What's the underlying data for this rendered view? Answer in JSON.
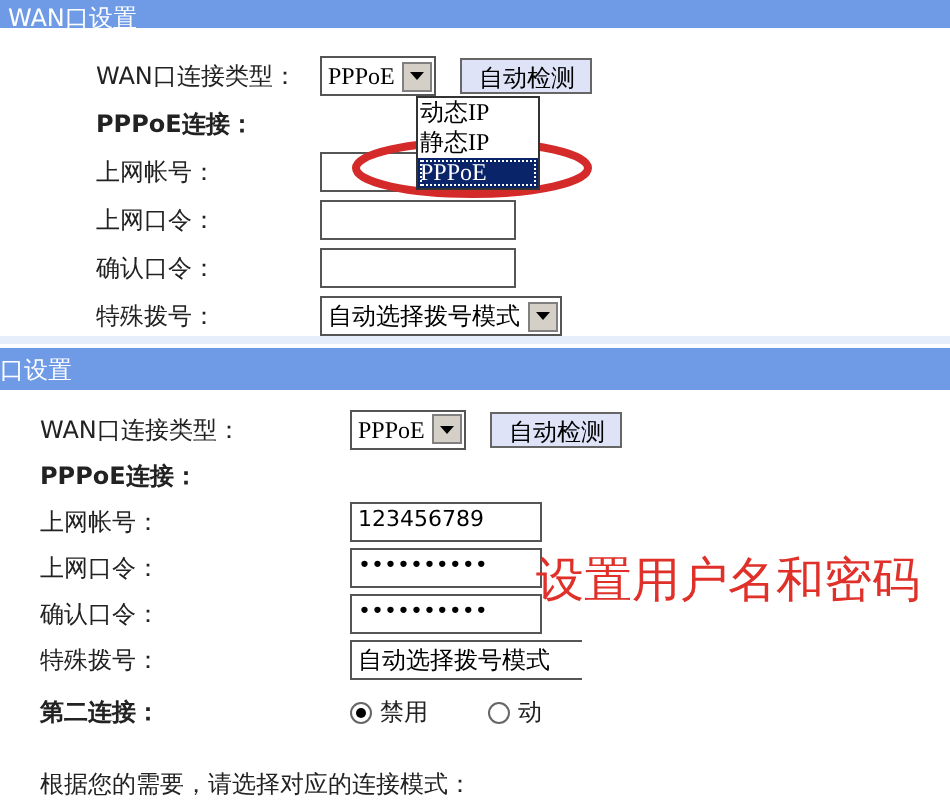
{
  "panels": [
    {
      "title": "WAN口设置",
      "rows": [
        {
          "kind": "select",
          "label": "WAN口连接类型：",
          "value": "PPPoE",
          "arrow": true,
          "button": "自动检测",
          "dropdown": [
            {
              "label": "动态IP",
              "selected": false
            },
            {
              "label": "静态IP",
              "selected": false
            },
            {
              "label": "PPPoE",
              "selected": true
            }
          ]
        },
        {
          "kind": "heading",
          "label": "PPPoE连接："
        },
        {
          "kind": "field",
          "label": "上网帐号：",
          "value": ""
        },
        {
          "kind": "field",
          "label": "上网口令：",
          "value": ""
        },
        {
          "kind": "field",
          "label": "确认口令：",
          "value": ""
        },
        {
          "kind": "select",
          "label": "特殊拨号：",
          "value": "自动选择拨号模式",
          "arrow": true
        }
      ]
    },
    {
      "title": "口设置",
      "rows": [
        {
          "kind": "select",
          "label": "WAN口连接类型：",
          "value": "PPPoE",
          "arrow": true,
          "button": "自动检测"
        },
        {
          "kind": "heading",
          "label": "PPPoE连接："
        },
        {
          "kind": "field",
          "label": "上网帐号：",
          "value": "123456789"
        },
        {
          "kind": "field",
          "label": "上网口令：",
          "value": "••••••••••"
        },
        {
          "kind": "field",
          "label": "确认口令：",
          "value": "••••••••••"
        },
        {
          "kind": "select",
          "label": "特殊拨号：",
          "value": "自动选择拨号模式",
          "arrow": false
        },
        {
          "kind": "radio",
          "label": "第二连接：",
          "options": [
            {
              "label": "禁用",
              "selected": true
            },
            {
              "label": "动",
              "selected": false
            }
          ]
        },
        {
          "kind": "note",
          "label": "根据您的需要，请选择对应的连接模式："
        }
      ]
    }
  ],
  "annotation": "设置用户名和密码"
}
